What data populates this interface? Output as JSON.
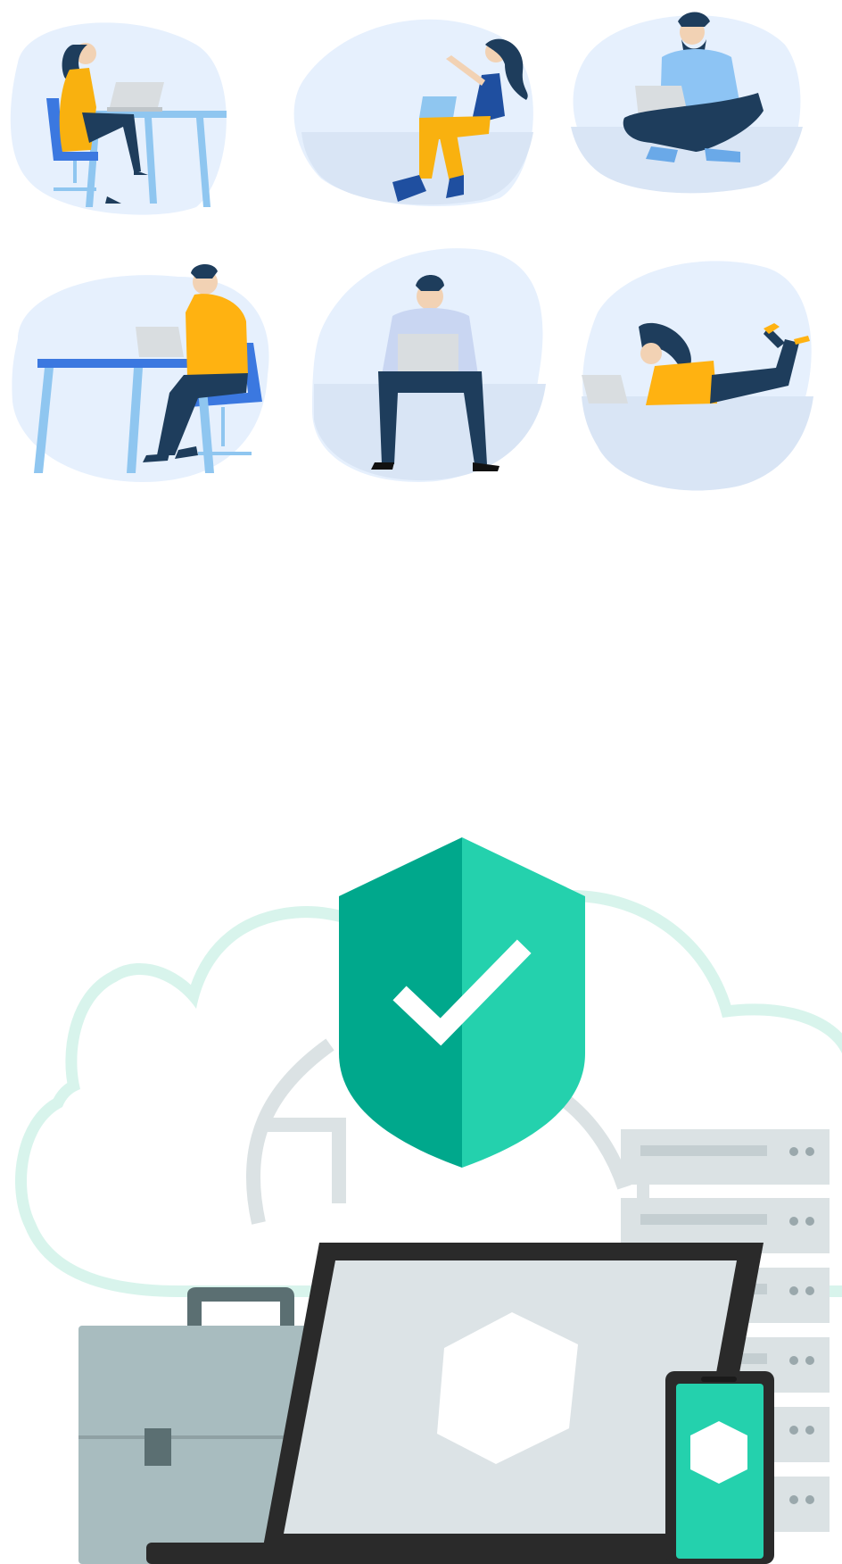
{
  "illustrations": {
    "people": {
      "figures": [
        {
          "name": "woman-at-desk",
          "shirt": "#f9b10f"
        },
        {
          "name": "woman-sitting-with-laptop",
          "shirt": "#f9b10f"
        },
        {
          "name": "bearded-man-cross-legged",
          "shirt": "#8dc4f4"
        },
        {
          "name": "man-at-desk-side",
          "shirt": "#ffb211"
        },
        {
          "name": "man-sitting-front",
          "shirt": "#c9d6f2"
        },
        {
          "name": "woman-lying-with-laptop",
          "shirt": "#ffb211"
        }
      ]
    },
    "security": {
      "icons": [
        "cloud-icon",
        "shield-check-icon",
        "sync-arrow-icon",
        "server-rack-icon",
        "briefcase-icon",
        "laptop-icon",
        "phone-icon"
      ]
    }
  },
  "colors": {
    "blob": "#e6f0fd",
    "blob_floor": "#d9e5f5",
    "navy": "#1e3d5c",
    "yellow": "#ffb211",
    "blue": "#3f7fe0",
    "skin": "#f2d2b4",
    "shield_dark": "#00a88c",
    "shield_light": "#24d1ad",
    "device_dark": "#2a2a2a",
    "screen": "#dce3e6",
    "server": "#dbe2e4",
    "briefcase": "#a8bcbf"
  }
}
